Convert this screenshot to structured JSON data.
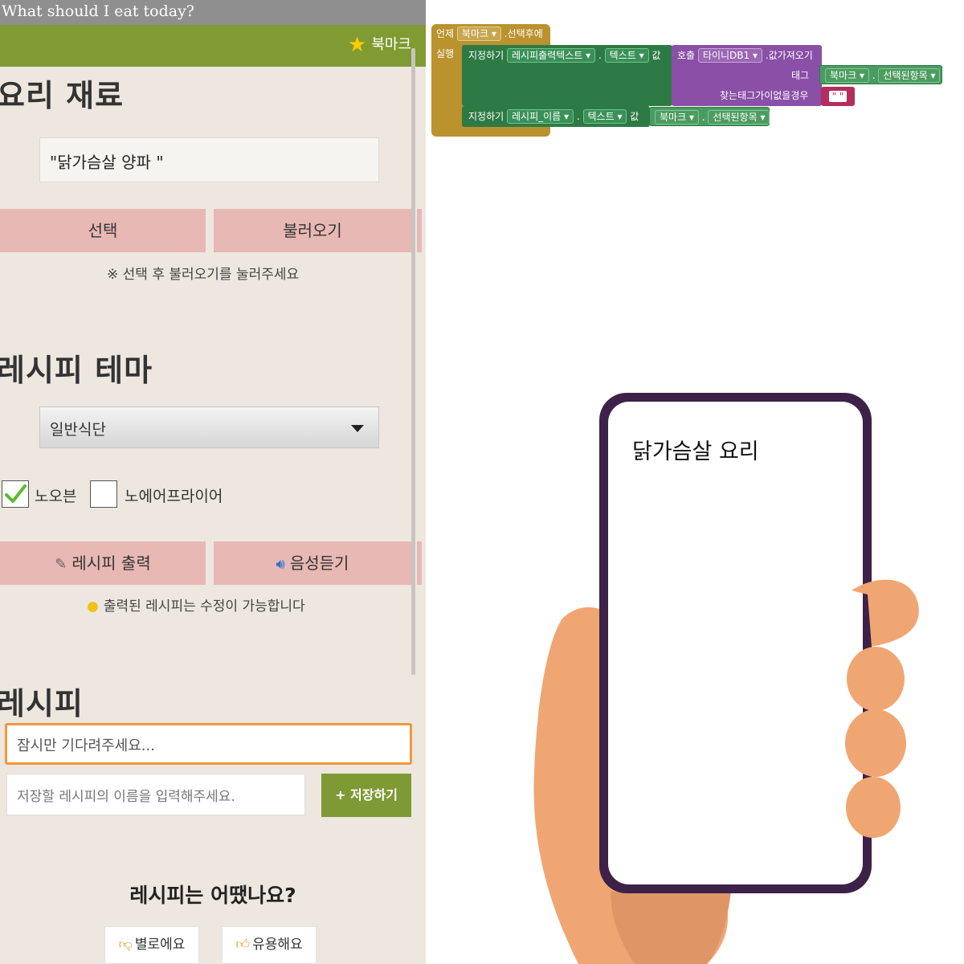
{
  "app": {
    "window_title": "What should I eat today?",
    "bookmark_label": "북마크",
    "ingredients_title": "요리 재료",
    "ingredients_value": "\"닭가슴살 양파 \"",
    "select_button": "선택",
    "load_button": "불러오기",
    "select_hint": "※ 선택 후 불러오기를 눌러주세요",
    "theme_title": "레시피 테마",
    "theme_selected": "일반식단",
    "checkbox_oven": {
      "label": "노오븐",
      "checked": true
    },
    "checkbox_airfryer": {
      "label": "노에어프라이어",
      "checked": false
    },
    "print_button": "레시피 출력",
    "listen_button": "음성듣기",
    "edit_hint": "출력된 레시피는 수정이 가능합니다",
    "recipe_title": "레시피",
    "recipe_text": "잠시만 기다려주세요...",
    "recipe_name_placeholder": "저장할 레시피의 이름을 입력해주세요.",
    "save_button": "+ 저장하기",
    "rating_question": "레시피는 어땠나요?",
    "rating_bad": "별로에요",
    "rating_good": "유용해요"
  },
  "blocks": {
    "when": "언제",
    "bookmark_component": "북마크",
    "after_picking": ".선택후에",
    "do": "실행",
    "set1": "지정하기",
    "recipe_output_textbox": "레시피출력텍스트",
    "text_prop1": "텍스트",
    "value1": "값",
    "call": "호출",
    "tinydb": "타이니DB1",
    "get_value": ".값가져오기",
    "tag": "태그",
    "bookmark_component2": "북마크",
    "selected_item": "선택된항목",
    "value_if_tag_not_there": "찾는태그가이없을경우",
    "empty_text": "\" \"",
    "set2": "지정하기",
    "recipe_name": "레시피_이름",
    "text_prop2": "텍스트",
    "value2": "값",
    "bookmark_component3": "북마크",
    "selected_item2": "선택된항목"
  },
  "illustration": {
    "caption": "닭가슴살 요리"
  },
  "colors": {
    "action_bar": "#7f9b32",
    "event_block": "#ba922e",
    "setter_block": "#2e7a45",
    "tinydb_block": "#8a4fa6",
    "text_block": "#b32d5e",
    "phone_frame": "#3d2148",
    "hand": "#f0a673"
  }
}
